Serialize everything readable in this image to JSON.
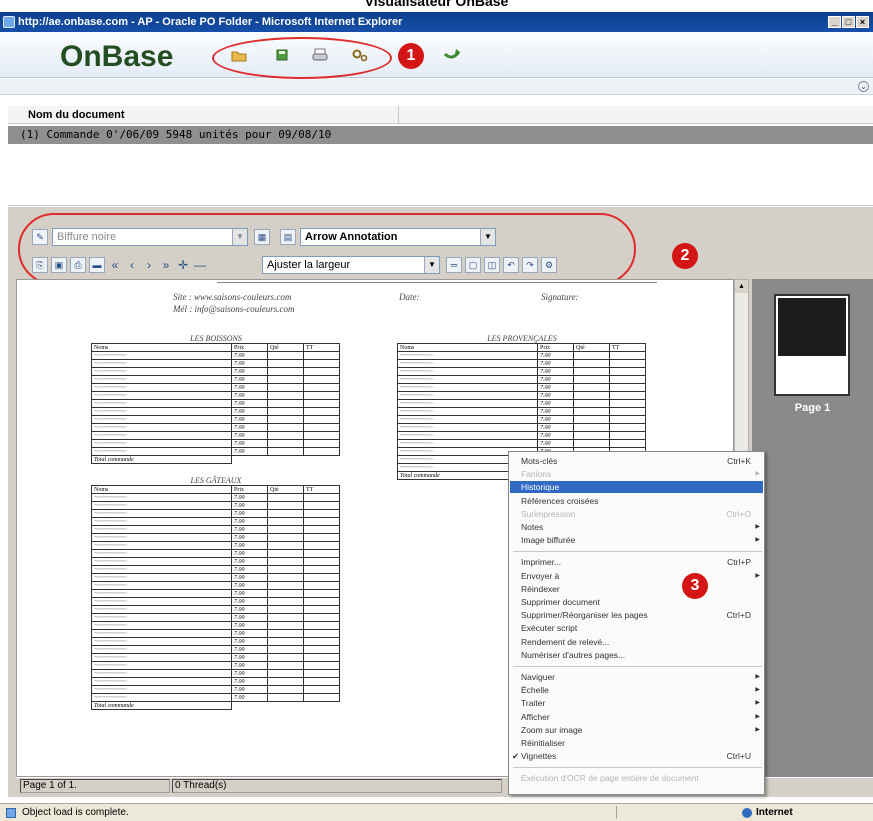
{
  "page_heading": "Visualisateur OnBase",
  "browser": {
    "title": "http://ae.onbase.com - AP - Oracle PO Folder - Microsoft Internet Explorer",
    "window_buttons": [
      "_",
      "□",
      "×"
    ],
    "status_text": "Object load is complete.",
    "zone": "Internet"
  },
  "app": {
    "logo": "OnBase",
    "toolbar_icons": [
      "folder-icon",
      "save-icon",
      "print-icon",
      "settings-icon"
    ],
    "return_icon": "return-icon"
  },
  "callouts": [
    "1",
    "2",
    "3"
  ],
  "document_list": {
    "column_header": "Nom du document",
    "rows": [
      {
        "prefix": "(1)",
        "name": "Commande 0'/06/09 5948 unités  pour 09/08/10"
      }
    ]
  },
  "viewer_toolbar": {
    "annotation_style": "Biffure noire",
    "annotation_type": "Arrow Annotation",
    "zoom": "Ajuster la largeur",
    "nav_glyphs": [
      "«",
      "‹",
      "›",
      "»"
    ]
  },
  "document_preview": {
    "site_line": "Site : www.saisons-couleurs.com",
    "mail_line": "Mél : info@saisons-couleurs.com",
    "date_label": "Date:",
    "signature_label": "Signature:",
    "tables": [
      {
        "title": "LES BOISSONS",
        "headers": [
          "Noms",
          "Prix",
          "Qté",
          "TT"
        ]
      },
      {
        "title": "LES PROVENÇALES",
        "headers": [
          "Noms",
          "Prix",
          "Qté",
          "TT"
        ]
      },
      {
        "title": "LES GÂTEAUX",
        "headers": [
          "Noms",
          "Prix",
          "Qté",
          "TT"
        ]
      }
    ],
    "row_price": "7.00",
    "total_label": "Total commande"
  },
  "thumbnails": [
    {
      "label": "Page 1"
    }
  ],
  "viewer_status": {
    "page": "Page 1 of 1.",
    "threads": "0 Thread(s)"
  },
  "context_menu": {
    "items": [
      {
        "label": "Mots-clés",
        "shortcut": "Ctrl+K"
      },
      {
        "label": "Fanions",
        "disabled": true,
        "submenu": true
      },
      {
        "label": "Historique",
        "selected": true
      },
      {
        "label": "Références croisées"
      },
      {
        "label": "Surimpression",
        "shortcut": "Ctrl+O",
        "disabled": true
      },
      {
        "label": "Notes",
        "submenu": true
      },
      {
        "label": "Image biffurée",
        "submenu": true
      },
      {
        "separator": true
      },
      {
        "label": "Imprimer...",
        "shortcut": "Ctrl+P"
      },
      {
        "label": "Envoyer à",
        "submenu": true
      },
      {
        "label": "Réindexer"
      },
      {
        "label": "Supprimer document"
      },
      {
        "label": "Supprimer/Réorganiser les pages",
        "shortcut": "Ctrl+D"
      },
      {
        "label": "Exécuter script"
      },
      {
        "label": "Rendement de relevé..."
      },
      {
        "label": "Numériser d'autres pages..."
      },
      {
        "separator": true
      },
      {
        "label": "Naviguer",
        "submenu": true
      },
      {
        "label": "Échelle",
        "submenu": true
      },
      {
        "label": "Traiter",
        "submenu": true
      },
      {
        "label": "Afficher",
        "submenu": true
      },
      {
        "label": "Zoom sur image",
        "submenu": true
      },
      {
        "label": "Réinitialiser"
      },
      {
        "label": "Vignettes",
        "shortcut": "Ctrl+U",
        "checked": true
      },
      {
        "separator": true
      },
      {
        "label": "Exécution d'OCR de page entière de document",
        "disabled": true
      }
    ]
  }
}
